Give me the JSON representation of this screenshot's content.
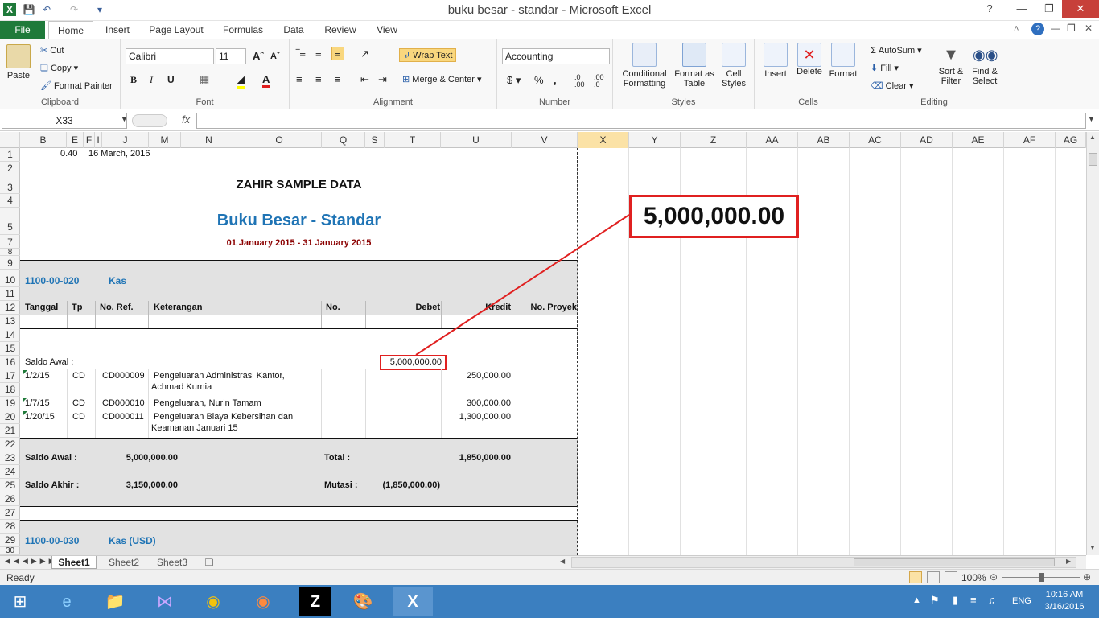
{
  "window": {
    "title": "buku besar - standar  -  Microsoft Excel"
  },
  "tabs": [
    "File",
    "Home",
    "Insert",
    "Page Layout",
    "Formulas",
    "Data",
    "Review",
    "View"
  ],
  "clipboard": {
    "paste": "Paste",
    "cut": "Cut",
    "copy": "Copy",
    "format_painter": "Format Painter",
    "label": "Clipboard"
  },
  "font": {
    "name": "Calibri",
    "size": "11",
    "label": "Font"
  },
  "alignment": {
    "wrap": "Wrap Text",
    "merge": "Merge & Center",
    "label": "Alignment"
  },
  "number": {
    "format": "Accounting",
    "label": "Number"
  },
  "styles": {
    "cond": "Conditional Formatting",
    "table": "Format as Table",
    "cell": "Cell Styles",
    "label": "Styles"
  },
  "cells": {
    "insert": "Insert",
    "delete": "Delete",
    "format": "Format",
    "label": "Cells"
  },
  "editing": {
    "autosum": "AutoSum",
    "fill": "Fill",
    "clear": "Clear",
    "sort": "Sort & Filter",
    "find": "Find & Select",
    "label": "Editing"
  },
  "formula": {
    "namebox": "X33",
    "fx": "fx"
  },
  "columns": [
    "B",
    "E",
    "F",
    "I",
    "J",
    "M",
    "N",
    "O",
    "Q",
    "S",
    "T",
    "U",
    "V",
    "X",
    "Y",
    "Z",
    "AA",
    "AB",
    "AC",
    "AD",
    "AE",
    "AF",
    "AG"
  ],
  "rows": [
    "1",
    "2",
    "3",
    "4",
    "5",
    "7",
    "8",
    "9",
    "10",
    "11",
    "12",
    "13",
    "14",
    "15",
    "16",
    "17",
    "18",
    "19",
    "20",
    "21",
    "22",
    "23",
    "24",
    "25",
    "26",
    "27",
    "28",
    "29",
    "30"
  ],
  "sheet": {
    "r1": {
      "num": "0.40",
      "date": "16 March, 2016"
    },
    "company": "ZAHIR SAMPLE DATA",
    "report_title": "Buku Besar - Standar",
    "period": "01 January 2015 - 31 January 2015",
    "account1": {
      "code": "1100-00-020",
      "name": "Kas"
    },
    "headers": {
      "tanggal": "Tanggal",
      "tp": "Tp",
      "noref": "No. Ref.",
      "ket": "Keterangan",
      "no": "No.",
      "debet": "Debet",
      "kredit": "Kredit",
      "proyek": "No. Proyek"
    },
    "saldo_awal_row": {
      "label": "Saldo Awal :",
      "debet": "5,000,000.00"
    },
    "entries": [
      {
        "date": "1/2/15",
        "tp": "CD",
        "ref": "CD000009",
        "ket1": "Pengeluaran Administrasi Kantor,",
        "ket2": "Achmad Kurnia",
        "kredit": "250,000.00"
      },
      {
        "date": "1/7/15",
        "tp": "CD",
        "ref": "CD000010",
        "ket1": "Pengeluaran, Nurin Tamam",
        "ket2": "",
        "kredit": "300,000.00"
      },
      {
        "date": "1/20/15",
        "tp": "CD",
        "ref": "CD000011",
        "ket1": "Pengeluaran Biaya Kebersihan dan",
        "ket2": "Keamanan Januari 15",
        "kredit": "1,300,000.00"
      }
    ],
    "summary": {
      "saldo_awal_label": "Saldo Awal :",
      "saldo_awal": "5,000,000.00",
      "total_label": "Total :",
      "total": "1,850,000.00",
      "saldo_akhir_label": "Saldo Akhir :",
      "saldo_akhir": "3,150,000.00",
      "mutasi_label": "Mutasi :",
      "mutasi": "(1,850,000.00)"
    },
    "account2": {
      "code": "1100-00-030",
      "name": "Kas (USD)"
    },
    "callout": "5,000,000.00"
  },
  "sheets": [
    "Sheet1",
    "Sheet2",
    "Sheet3"
  ],
  "status": {
    "ready": "Ready",
    "zoom": "100%"
  },
  "clock": {
    "time": "10:16 AM",
    "date": "3/16/2016",
    "lang": "ENG"
  },
  "colors": {
    "accent": "#1f7a3a",
    "blue_text": "#1f74b5",
    "red": "#e02020",
    "dark_red": "#8b0000"
  }
}
